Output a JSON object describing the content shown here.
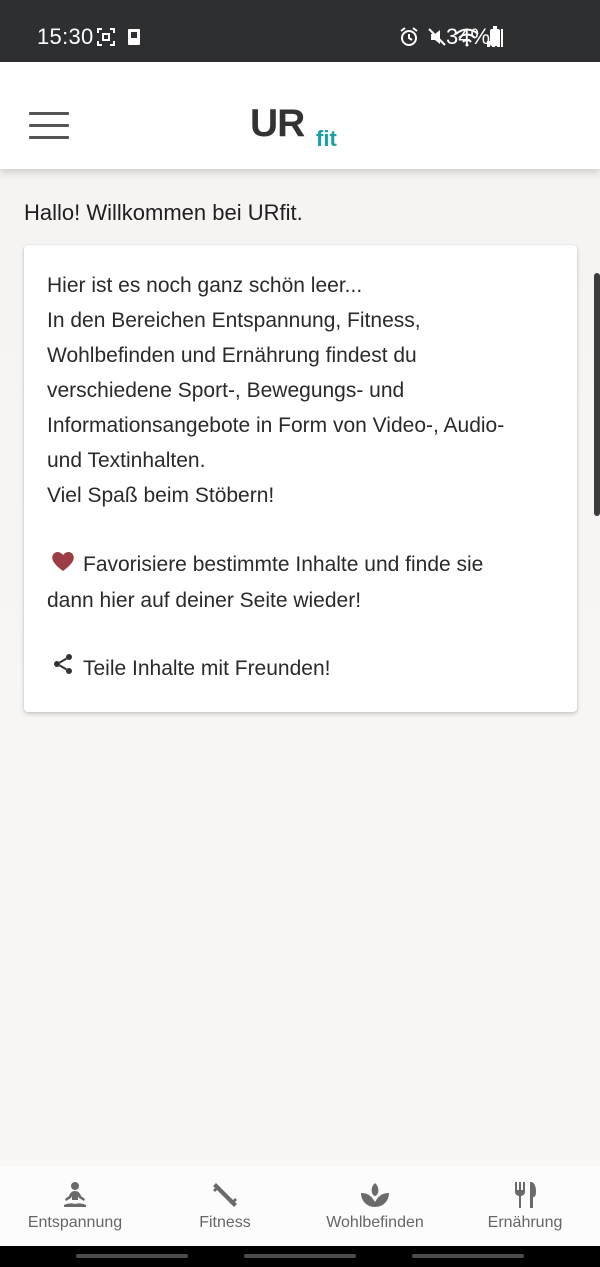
{
  "status_bar": {
    "time": "15:30",
    "battery": "34%",
    "icons": [
      "screenshot-icon",
      "phone-icon",
      "alarm-icon",
      "mute-icon",
      "wifi-icon",
      "signal-icon",
      "battery-icon"
    ]
  },
  "header": {
    "logo_main": "UR",
    "logo_sub": "fit",
    "menu_icon": "hamburger-menu-icon",
    "colors": {
      "logo_main": "#333333",
      "logo_sub": "#1aa1a0"
    }
  },
  "main": {
    "welcome": "Hallo! Willkommen bei URfit.",
    "card": {
      "lines": [
        "Hier ist es noch ganz schön leer...",
        "In den Bereichen Entspannung, Fitness,",
        "Wohlbefinden und Ernährung findest du",
        "verschiedene Sport-, Bewegungs- und",
        "Informationsangebote in Form von Video-, Audio-",
        "und Textinhalten.",
        "Viel Spaß beim Stöbern!"
      ],
      "favorite_line_1": "Favorisiere bestimmte Inhalte und finde sie",
      "favorite_line_2": "dann hier auf deiner Seite wieder!",
      "share_text": "Teile Inhalte mit Freunden!",
      "heart_icon": "heart-icon",
      "share_icon": "share-icon",
      "colors": {
        "heart": "#9c3d46"
      }
    }
  },
  "bottom_nav": {
    "items": [
      {
        "label": "Entspannung",
        "icon": "meditation-icon"
      },
      {
        "label": "Fitness",
        "icon": "dumbbell-icon"
      },
      {
        "label": "Wohlbefinden",
        "icon": "lotus-icon"
      },
      {
        "label": "Ernährung",
        "icon": "fork-knife-icon"
      }
    ]
  }
}
